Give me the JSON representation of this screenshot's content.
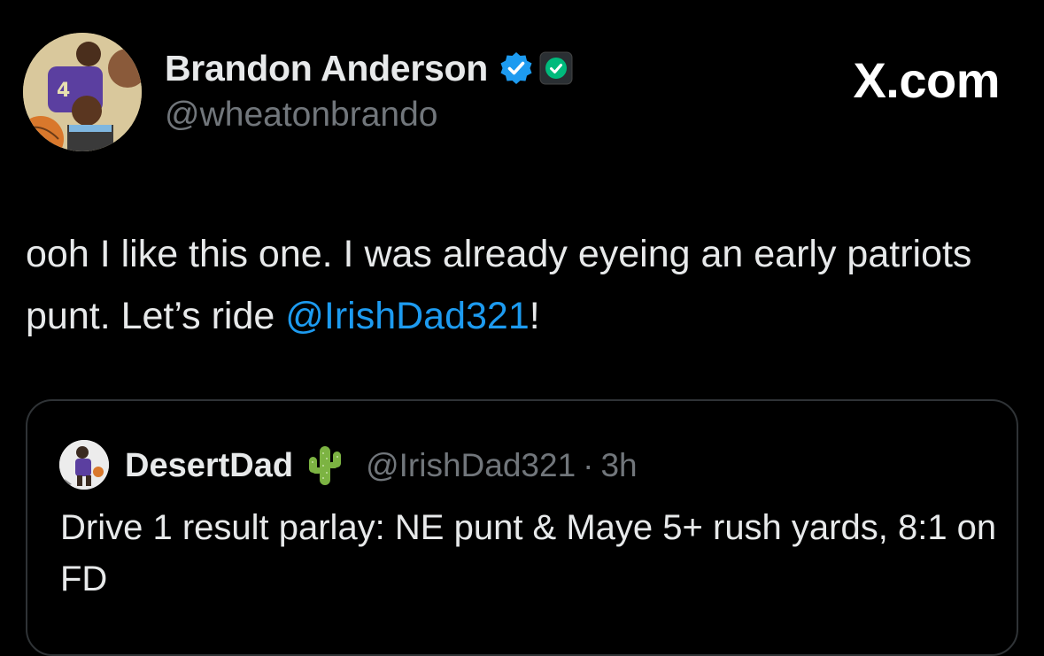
{
  "tweet": {
    "author": {
      "name": "Brandon Anderson",
      "handle": "@wheatonbrando",
      "verified": true,
      "avatar_icon": "profile-photo-basketball-football"
    },
    "brand": "X.com",
    "text_before_mention": "ooh I like this one. I was already eyeing an early patriots punt. Let’s ride ",
    "mention": "@IrishDad321",
    "text_after_mention": "!"
  },
  "quote": {
    "author": {
      "name": "DesertDad",
      "emoji_icon": "cactus-icon",
      "handle": "@IrishDad321",
      "separator": "·",
      "time": "3h"
    },
    "text": "Drive 1 result parlay: NE punt & Maye 5+ rush yards, 8:1 on FD"
  },
  "colors": {
    "background": "#000000",
    "text_primary": "#e7e9ea",
    "text_secondary": "#71767b",
    "link": "#1d9bf0",
    "verified_badge": "#1d9bf0",
    "affiliate_badge": "#00ba7c",
    "card_border": "#2f3336"
  }
}
